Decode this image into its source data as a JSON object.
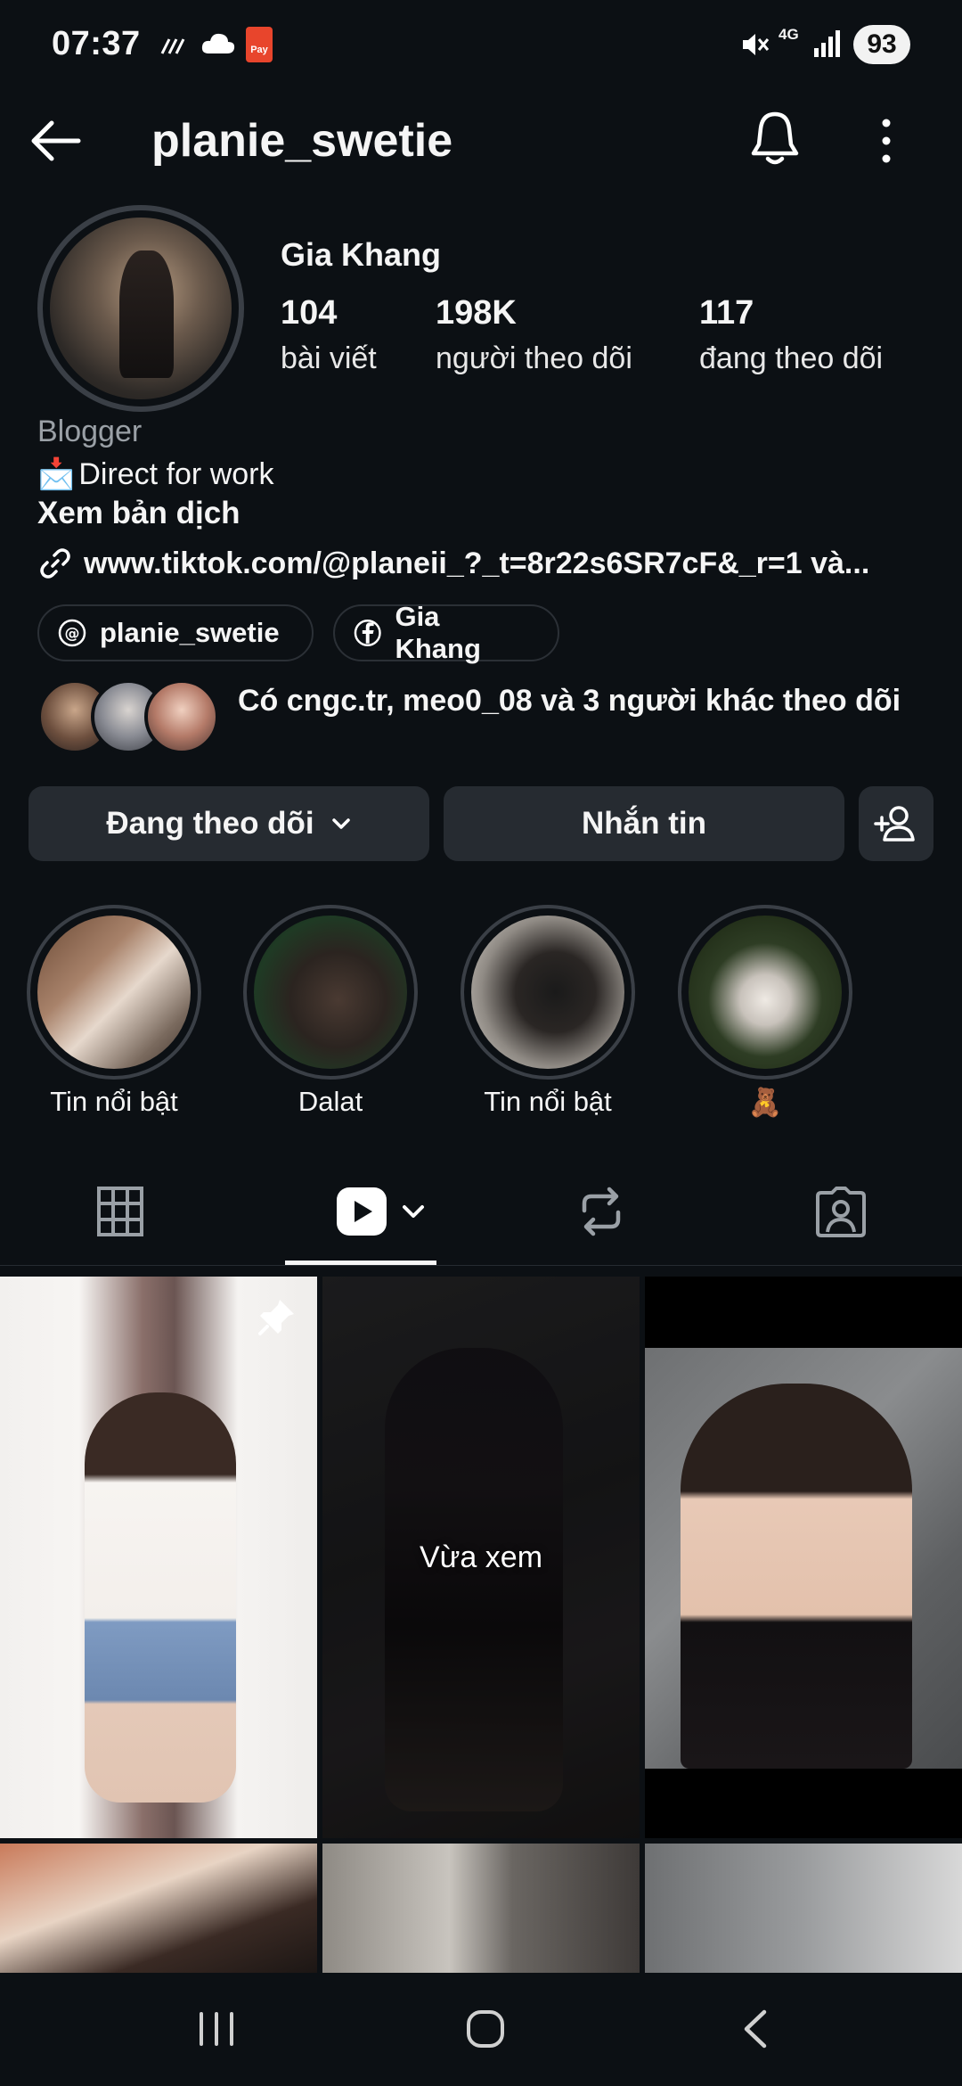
{
  "status_bar": {
    "time": "07:37",
    "battery": "93",
    "pay_label": "Pay",
    "network_label": "4G"
  },
  "header": {
    "username": "planie_swetie",
    "back_icon": "arrow-left-icon",
    "bell_icon": "bell-icon",
    "more_icon": "more-vertical-icon"
  },
  "profile": {
    "full_name": "Gia Khang",
    "stats": [
      {
        "value": "104",
        "label": "bài viết"
      },
      {
        "value": "198K",
        "label": "người theo dõi"
      },
      {
        "value": "117",
        "label": "đang theo dõi"
      }
    ],
    "category": "Blogger",
    "bio_line": "Direct for work",
    "bio_emoji": "📩",
    "translate_link": "Xem bản dịch",
    "website": "www.tiktok.com/@planeii_?_t=8r22s6SR7cF&_r=1 và...",
    "chips": [
      {
        "label": "planie_swetie",
        "icon": "threads-icon"
      },
      {
        "label": "Gia Khang",
        "icon": "facebook-icon"
      }
    ],
    "followed_by_text": "Có cngc.tr, meo0_08 và 3 người khác theo dõi"
  },
  "actions": {
    "following_label": "Đang theo dõi",
    "message_label": "Nhắn tin",
    "add_user_icon": "add-user-icon"
  },
  "highlights": [
    {
      "label": "Tin nổi bật"
    },
    {
      "label": "Dalat"
    },
    {
      "label": "Tin nổi bật"
    },
    {
      "label": "🧸"
    }
  ],
  "tabs": [
    {
      "name": "grid",
      "icon": "grid-icon"
    },
    {
      "name": "reels",
      "icon": "reels-icon"
    },
    {
      "name": "reposts",
      "icon": "repost-icon"
    },
    {
      "name": "tagged",
      "icon": "tagged-icon"
    }
  ],
  "grid": {
    "watched_label": "Vừa xem"
  },
  "colors": {
    "background": "#0c1014",
    "button": "#262b31",
    "muted_text": "#9aa0a6",
    "text": "#f5f5f5"
  }
}
